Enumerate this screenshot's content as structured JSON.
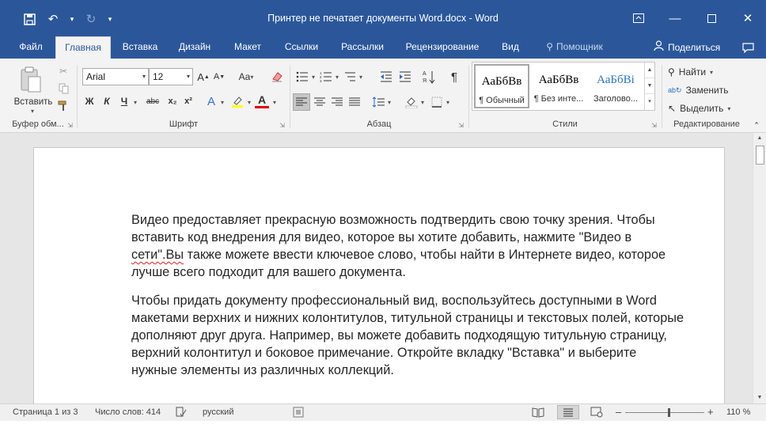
{
  "window": {
    "title": "Принтер не печатает документы Word.docx  -  Word",
    "accent_color": "#2b579a"
  },
  "qat": {
    "save_icon": "save-icon",
    "undo_icon": "undo-icon",
    "redo_icon": "redo-icon",
    "customize_icon": "customize-qat-icon"
  },
  "tabs": [
    {
      "label": "Файл"
    },
    {
      "label": "Главная"
    },
    {
      "label": "Вставка"
    },
    {
      "label": "Дизайн"
    },
    {
      "label": "Макет"
    },
    {
      "label": "Ссылки"
    },
    {
      "label": "Рассылки"
    },
    {
      "label": "Рецензирование"
    },
    {
      "label": "Вид"
    }
  ],
  "active_tab": "Главная",
  "tell_me": "Помощник",
  "share_label": "Поделиться",
  "ribbon": {
    "clipboard": {
      "label": "Буфер обм...",
      "paste_label": "Вставить"
    },
    "font": {
      "label": "Шрифт",
      "font_name": "Arial",
      "font_size": "12",
      "grow": "A",
      "shrink": "A",
      "case": "Aa",
      "bold": "Ж",
      "italic": "К",
      "underline": "Ч",
      "strike": "abc",
      "subscript": "x₂",
      "superscript": "x²",
      "text_effect": "A",
      "font_color": "A"
    },
    "paragraph": {
      "label": "Абзац",
      "pilcrow": "¶"
    },
    "styles": {
      "label": "Стили",
      "items": [
        {
          "sample": "АаБбВв",
          "name": "¶ Обычный",
          "color": "#000000"
        },
        {
          "sample": "АаБбВв",
          "name": "¶ Без инте...",
          "color": "#000000"
        },
        {
          "sample": "АаБбВі",
          "name": "Заголово...",
          "color": "#2e74b5"
        }
      ]
    },
    "editing": {
      "label": "Редактирование",
      "find": "Найти",
      "replace": "Заменить",
      "select": "Выделить"
    }
  },
  "document": {
    "paragraphs": [
      {
        "before": "Видео предоставляет прекрасную возможность подтвердить свою точку зрения. Чтобы вставить код внедрения для видео, которое вы хотите добавить, нажмите \"Видео в ",
        "flagged": "сети\".Вы",
        "after": " также можете ввести ключевое слово, чтобы найти в Интернете видео, которое лучше всего подходит для вашего документа."
      },
      {
        "before": "Чтобы придать документу профессиональный вид, воспользуйтесь доступными в Word макетами верхних и нижних колонтитулов, титульной страницы и текстовых полей, которые дополняют друг друга. Например, вы можете добавить подходящую титульную страницу, верхний колонтитул и боковое примечание. Откройте вкладку \"Вставка\" и выберите нужные элементы из различных коллекций.",
        "flagged": "",
        "after": ""
      }
    ]
  },
  "status": {
    "page": "Страница 1 из 3",
    "words": "Число слов: 414",
    "language": "русский",
    "zoom": "110 %",
    "zoom_fraction": 0.55
  }
}
